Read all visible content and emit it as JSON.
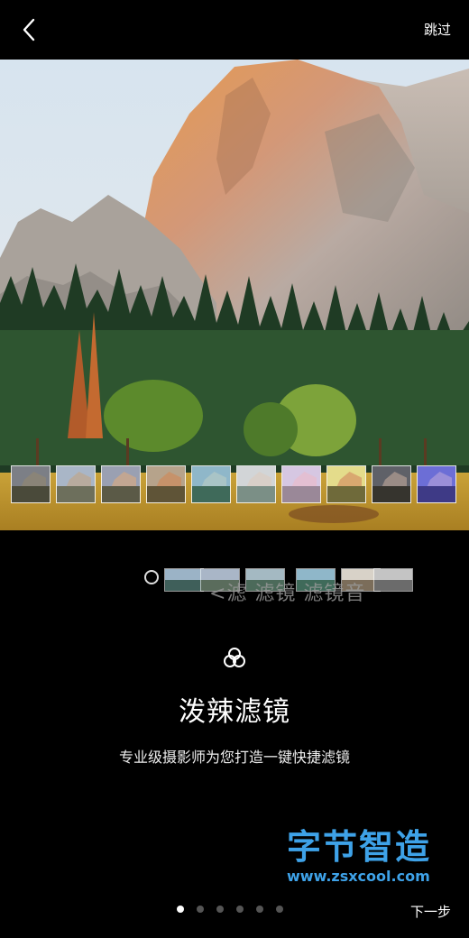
{
  "topbar": {
    "skip_label": "跳过"
  },
  "feature": {
    "title": "泼辣滤镜",
    "subtitle": "专业级摄影师为您打造一键快捷滤镜"
  },
  "ghost_strip_text": "<滤 滤镜 滤镜音",
  "watermark": {
    "title": "字节智造",
    "url": "www.zsxcool.com"
  },
  "pager": {
    "count": 6,
    "active_index": 0,
    "next_label": "下一步"
  },
  "thumbnails": [
    {
      "sky": "#7c7f86",
      "rock": "#8a8478",
      "ground": "#4a4a3a"
    },
    {
      "sky": "#a9b6c7",
      "rock": "#b8ab9e",
      "ground": "#6d6f5c"
    },
    {
      "sky": "#9aa0b2",
      "rock": "#c2a692",
      "ground": "#5b5a47"
    },
    {
      "sky": "#b6a38b",
      "rock": "#c6926a",
      "ground": "#5f5437"
    },
    {
      "sky": "#8fb7c9",
      "rock": "#a9c4c6",
      "ground": "#3f6a5a"
    },
    {
      "sky": "#d2d5d7",
      "rock": "#d8cfc8",
      "ground": "#7b8f86"
    },
    {
      "sky": "#d6c7e2",
      "rock": "#e3bfd2",
      "ground": "#9a8898"
    },
    {
      "sky": "#e4dc8b",
      "rock": "#d9a870",
      "ground": "#6f6a3a"
    },
    {
      "sky": "#5f6168",
      "rock": "#9a8c86",
      "ground": "#36342e"
    },
    {
      "sky": "#6c6ed6",
      "rock": "#9b8fd8",
      "ground": "#3e3a86"
    }
  ]
}
